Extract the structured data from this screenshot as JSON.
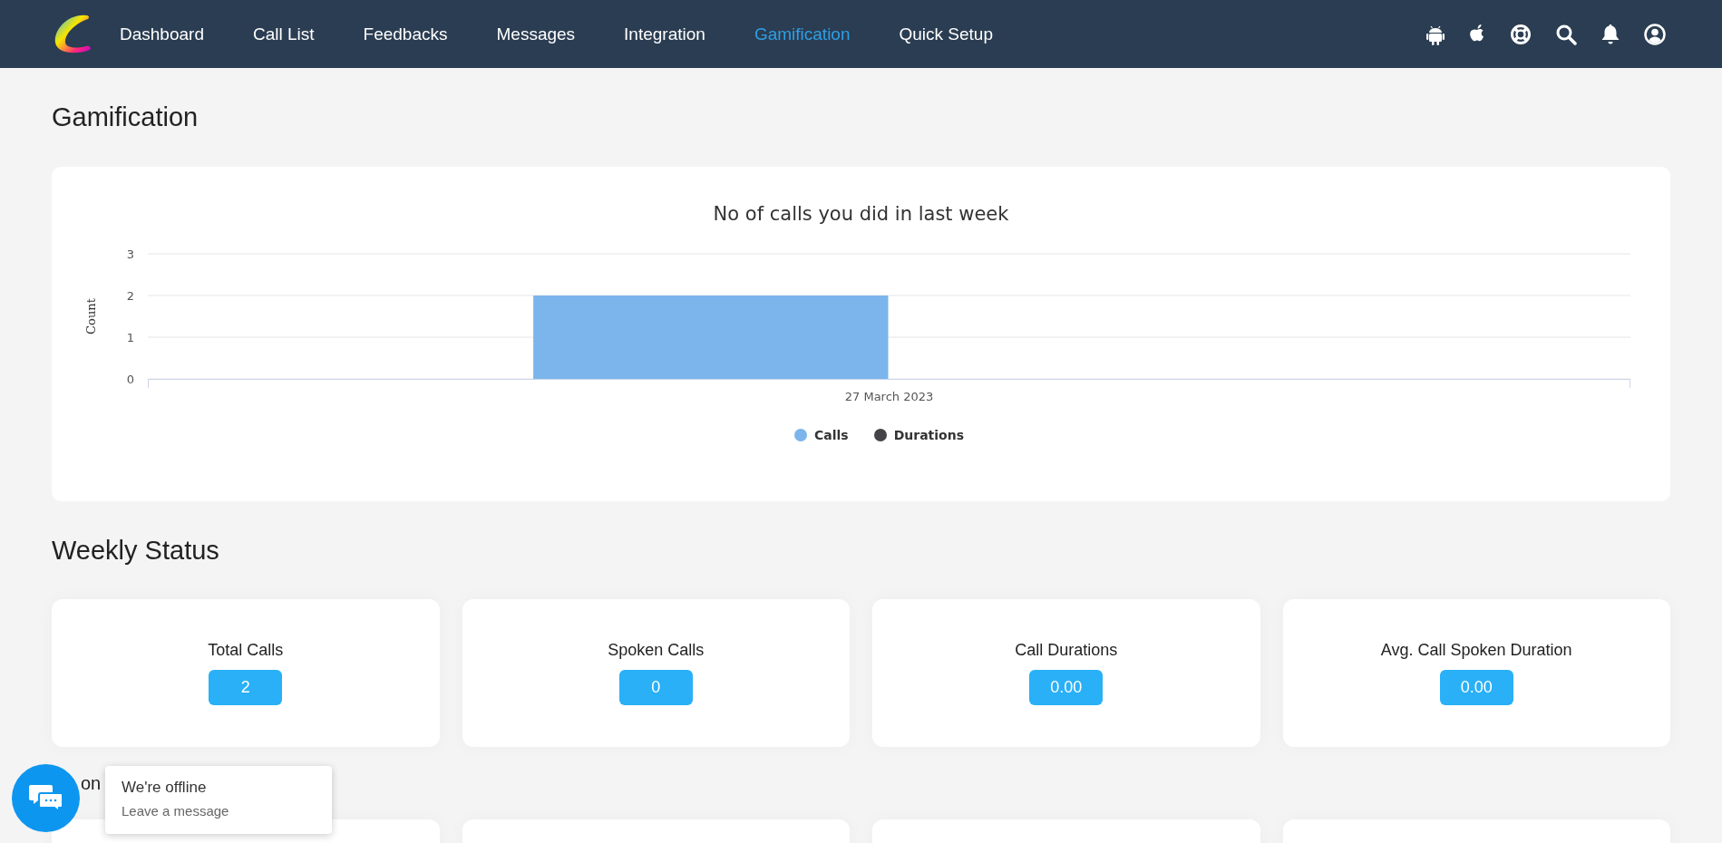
{
  "nav": {
    "items": [
      {
        "label": "Dashboard",
        "selected": false
      },
      {
        "label": "Call List",
        "selected": false
      },
      {
        "label": "Feedbacks",
        "selected": false
      },
      {
        "label": "Messages",
        "selected": false
      },
      {
        "label": "Integration",
        "selected": false
      },
      {
        "label": "Gamification",
        "selected": true
      },
      {
        "label": "Quick Setup",
        "selected": false
      }
    ]
  },
  "page_title": "Gamification",
  "chart": {
    "chart_data": {
      "type": "bar",
      "title": "No of calls you did in last week",
      "ylabel": "Count",
      "categories": [
        "27 March 2023"
      ],
      "series": [
        {
          "name": "Calls",
          "color": "#7cb5ec",
          "values": [
            2
          ]
        },
        {
          "name": "Durations",
          "color": "#434348",
          "values": [
            0
          ]
        }
      ],
      "ylim": [
        0,
        3
      ],
      "yticks": [
        0,
        1,
        2,
        3
      ]
    }
  },
  "weekly_status": {
    "title": "Weekly Status",
    "cards": [
      {
        "label": "Total Calls",
        "value": "2"
      },
      {
        "label": "Spoken Calls",
        "value": "0"
      },
      {
        "label": "Call Durations",
        "value": "0.00"
      },
      {
        "label": "Avg. Call Spoken Duration",
        "value": "0.00"
      }
    ]
  },
  "next_section": {
    "title": "on"
  },
  "chat_widget": {
    "status": "We're offline",
    "action": "Leave a message"
  }
}
